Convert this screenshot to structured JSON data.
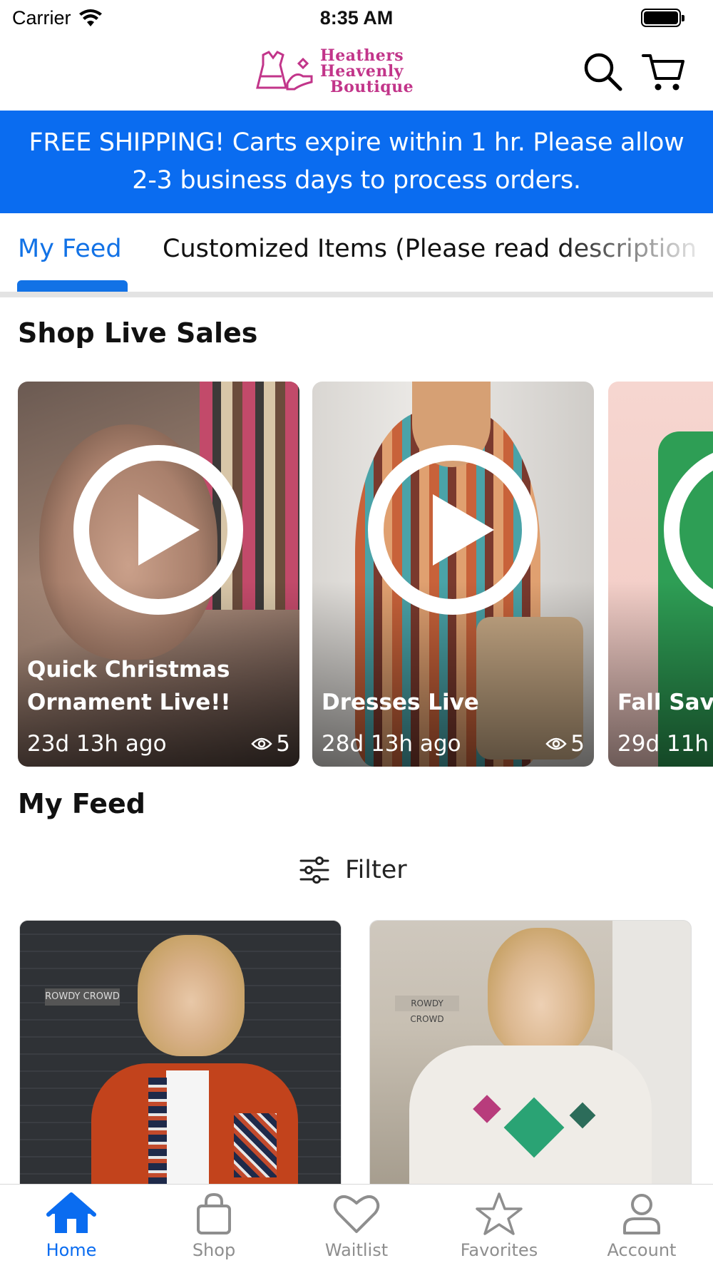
{
  "status_bar": {
    "carrier": "Carrier",
    "time": "8:35 AM"
  },
  "header": {
    "logo_line1": "Heathers",
    "logo_line2": "Heavenly",
    "logo_line3": "Boutique",
    "icons": [
      "search-icon",
      "cart-icon"
    ]
  },
  "banner": {
    "text": "FREE SHIPPING! Carts expire within 1 hr. Please allow 2-3 business days to process orders."
  },
  "tabs": [
    {
      "label": "My Feed",
      "active": true
    },
    {
      "label": "Customized Items (Please read description",
      "active": false
    }
  ],
  "live_sales": {
    "title": "Shop Live Sales",
    "cards": [
      {
        "title": "Quick Christmas Ornament Live!!",
        "ago": "23d 13h ago",
        "views": "5"
      },
      {
        "title": "Dresses Live",
        "ago": "28d 13h ago",
        "views": "5"
      },
      {
        "title": "Fall Save",
        "ago": "29d 11h",
        "views": ""
      }
    ]
  },
  "feed": {
    "title": "My Feed",
    "filter_label": "Filter",
    "product_brand": "ROWDY CROWD"
  },
  "bottom_nav": [
    {
      "label": "Home",
      "icon": "home-icon",
      "active": true
    },
    {
      "label": "Shop",
      "icon": "bag-icon",
      "active": false
    },
    {
      "label": "Waitlist",
      "icon": "heart-icon",
      "active": false
    },
    {
      "label": "Favorites",
      "icon": "star-icon",
      "active": false
    },
    {
      "label": "Account",
      "icon": "person-icon",
      "active": false
    }
  ],
  "colors": {
    "accent": "#0a6cf0",
    "logo": "#c2358a",
    "inactive_nav": "#8e8e8e"
  }
}
